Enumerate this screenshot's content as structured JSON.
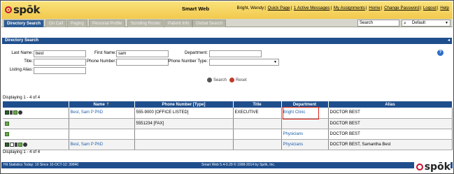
{
  "header": {
    "logo_text": "spōk",
    "app_title": "Smart Web",
    "user": "Bright, Wendy",
    "links": [
      "Quick Page",
      "1 Active Messages",
      "My Assignments",
      "Home",
      "Change Password",
      "Logout",
      "Help"
    ]
  },
  "tabs": [
    "Directory Search",
    "On Call",
    "Paging",
    "Personal Profile",
    "Scrolling Roster",
    "Patient Info",
    "Global Search"
  ],
  "search": {
    "value": "Search",
    "scope": "Default"
  },
  "panel": {
    "title": "Directory Search",
    "fields": {
      "last_name_label": "Last Name:",
      "last_name_value": "best",
      "first_name_label": "First Name:",
      "first_name_value": "sam",
      "department_label": "Department:",
      "department_value": "",
      "title_label": "Title:",
      "title_value": "",
      "phone_label": "Phone Number:",
      "phone_value": "",
      "phone_type_label": "Phone Number Type:",
      "phone_type_value": "",
      "listing_alias_label": "Listing Alias:",
      "listing_alias_value": ""
    },
    "search_btn": "Search",
    "reset_btn": "Reset",
    "help": "?"
  },
  "results": {
    "count_text": "Displaying 1 - 4 of 4",
    "columns": [
      "",
      "Name",
      "Phone Number [Type]",
      "Title",
      "Department",
      "Alias"
    ],
    "rows": [
      {
        "icons": [
          "pager",
          "cell",
          "card",
          "dial"
        ],
        "name": "Best, Sam P PhD",
        "phone": "555-9000 [OFFICE LISTED]",
        "title": "EXECUTIVE",
        "department": "Bright Clinic",
        "alias": "DOCTOR BEST"
      },
      {
        "icons": [
          "card"
        ],
        "name": "",
        "phone": "5551234 [FAX]",
        "title": "",
        "department": "",
        "alias": "DOCTOR BEST"
      },
      {
        "icons": [
          "card"
        ],
        "name": "",
        "phone": "",
        "title": "",
        "department": "Physicians",
        "alias": "DOCTOR BEST"
      },
      {
        "icons": [
          "pager",
          "mail",
          "cell",
          "card",
          "dial"
        ],
        "name": "Best, Sam P PhD",
        "phone": "",
        "title": "",
        "department": "Physicians",
        "alias": "DOCTOR BEST, Samantha Best"
      }
    ]
  },
  "footer": {
    "left": "Hit Statistics Today: 10 Since 10-OCT-12: 39840",
    "center": "Smart Web 5.4-0.29 © 1998-2014 by Spōk, Inc.",
    "brand": "spōk"
  }
}
